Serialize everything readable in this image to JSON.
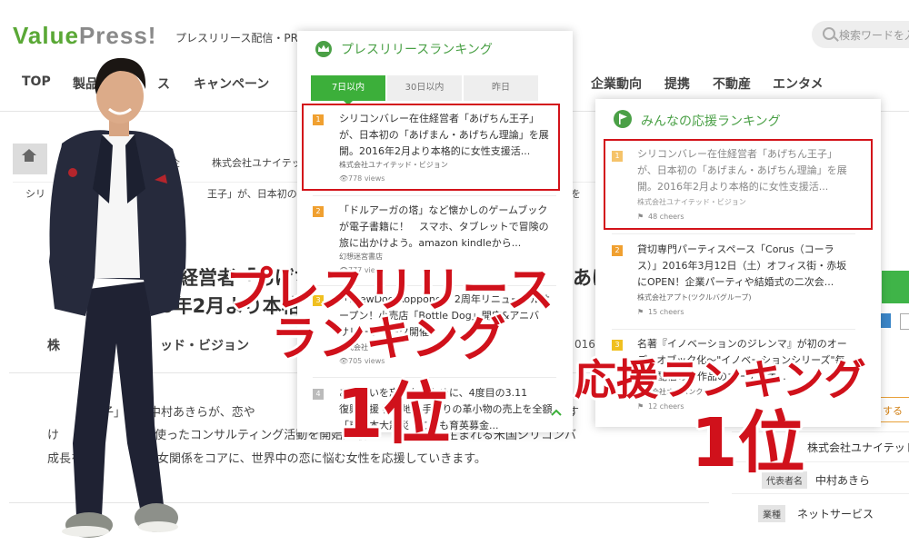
{
  "site": {
    "logo_main": "Value",
    "logo_second": "Press",
    "logo_bang": "!",
    "tagline": "プレスリリース配信・PR"
  },
  "search": {
    "placeholder": "検索ワードを入"
  },
  "nav": {
    "items": [
      "TOP",
      "製品",
      "ス",
      "キャンペーン",
      "企業動向",
      "提携",
      "不動産",
      "エンタメ"
    ]
  },
  "breadcrumb": {
    "item_fragment": "企",
    "company_fragment": "株式会社ユナイテッド"
  },
  "subtitle_fragments": [
    "シリ",
    "王子」が、日本初の「あげ",
    "を"
  ],
  "article": {
    "title_line1": "住経営者「あげち",
    "title_line1_end": "あげ",
    "title_line2": "6年2月より本格",
    "company_fragment": "ッド・ビジョン",
    "company_prefix": "株",
    "date_fragment": "016",
    "body": [
      "子」こと中村あきらが、恋や",
      "決す",
      "を使ったコンサルティング活動を開始。最",
      "が生まれる米国シリコンバ",
      "成長を",
      "男女関係をコアに、世界中の恋に悩む女性を応援していきます。"
    ],
    "body_prefix": "け"
  },
  "right_info": {
    "button_fragment": "する",
    "company_value": "株式会社ユナイテッド",
    "rep_label": "代表者名",
    "rep_value": "中村あきら",
    "industry_label": "業種",
    "industry_value": "ネットサービス"
  },
  "press_ranking": {
    "title": "プレスリリースランキング",
    "icon": "crown-icon",
    "tabs": [
      {
        "label": "7日以内",
        "active": true
      },
      {
        "label": "30日以内",
        "active": false
      },
      {
        "label": "昨日",
        "active": false
      }
    ],
    "items": [
      {
        "rank": "1",
        "title_lines": [
          "シリコンバレー在住経営者「あげちん王子」",
          "が、日本初の「あげまん・あげちん理論」を展",
          "開。2016年2月より本格的に女性支援活..."
        ],
        "company": "株式会社ユナイテッド・ビジョン",
        "stat": "778 views",
        "highlighted": true
      },
      {
        "rank": "2",
        "title_lines": [
          "「ドルアーガの塔」など懐かしのゲームブック",
          "が電子書籍に！　スマホ、タブレットで冒険の",
          "旅に出かけよう。amazon kindleから..."
        ],
        "company": "幻想迷宮書店",
        "stat": "777 views",
        "highlighted": false
      },
      {
        "rank": "3",
        "title_lines": [
          "「BrewDog Roppongi」2周年リニューアルオ",
          "ープン！小売店「Bottle Dog」開店&アニバ",
          "サリーウィーク開催"
        ],
        "company": "株式会社",
        "stat": "705 views",
        "highlighted": false
      },
      {
        "rank": "4",
        "title_lines": [
          "あの想いを忘れないために、4度目の3.11",
          "復興支援 被災地の手作りの革小物の売上を全額",
          "「東日本大震災・こども育英募金..."
        ],
        "company": "",
        "stat": "",
        "highlighted": false
      }
    ],
    "scroll_up_icon": "chevron-up-icon"
  },
  "cheer_ranking": {
    "title": "みんなの応援ランキング",
    "icon": "flag-icon",
    "items": [
      {
        "rank": "1",
        "title_lines": [
          "シリコンバレー在住経営者「あげちん王子」",
          "が、日本初の「あげまん・あげちん理論」を展",
          "開。2016年2月より本格的に女性支援活..."
        ],
        "company": "株式会社ユナイテッド・ビジョン",
        "stat": "48 cheers",
        "highlighted": true
      },
      {
        "rank": "2",
        "title_lines": [
          "貸切専門パーティスペース「Corus（コーラ",
          "ス）」2016年3月12日（土）オフィス街・赤坂",
          "にOPEN！企業パーティや結婚式の二次会..."
        ],
        "company": "株式会社アプト(ツクルバグループ)",
        "stat": "15 cheers",
        "highlighted": false
      },
      {
        "rank": "3",
        "title_lines": [
          "名著『イノベーションのジレンマ』が初のオー",
          "ディオブック化〜\"イノベーションシリーズ\"毎",
          "月の配信の外作品のオーディオ..."
        ],
        "company": "株式会社オトバンク",
        "stat": "12 cheers",
        "highlighted": false
      }
    ]
  },
  "overlays": {
    "press_line1": "プレスリリース",
    "press_line2": "ランキング",
    "press_rank": "1位",
    "cheer_line1": "応援ランキング",
    "cheer_rank": "1位"
  },
  "colors": {
    "brand_green": "#5aa836",
    "tab_active": "#3caf3a",
    "highlight_red": "#d3131a",
    "overlay_red": "#d0111b"
  }
}
